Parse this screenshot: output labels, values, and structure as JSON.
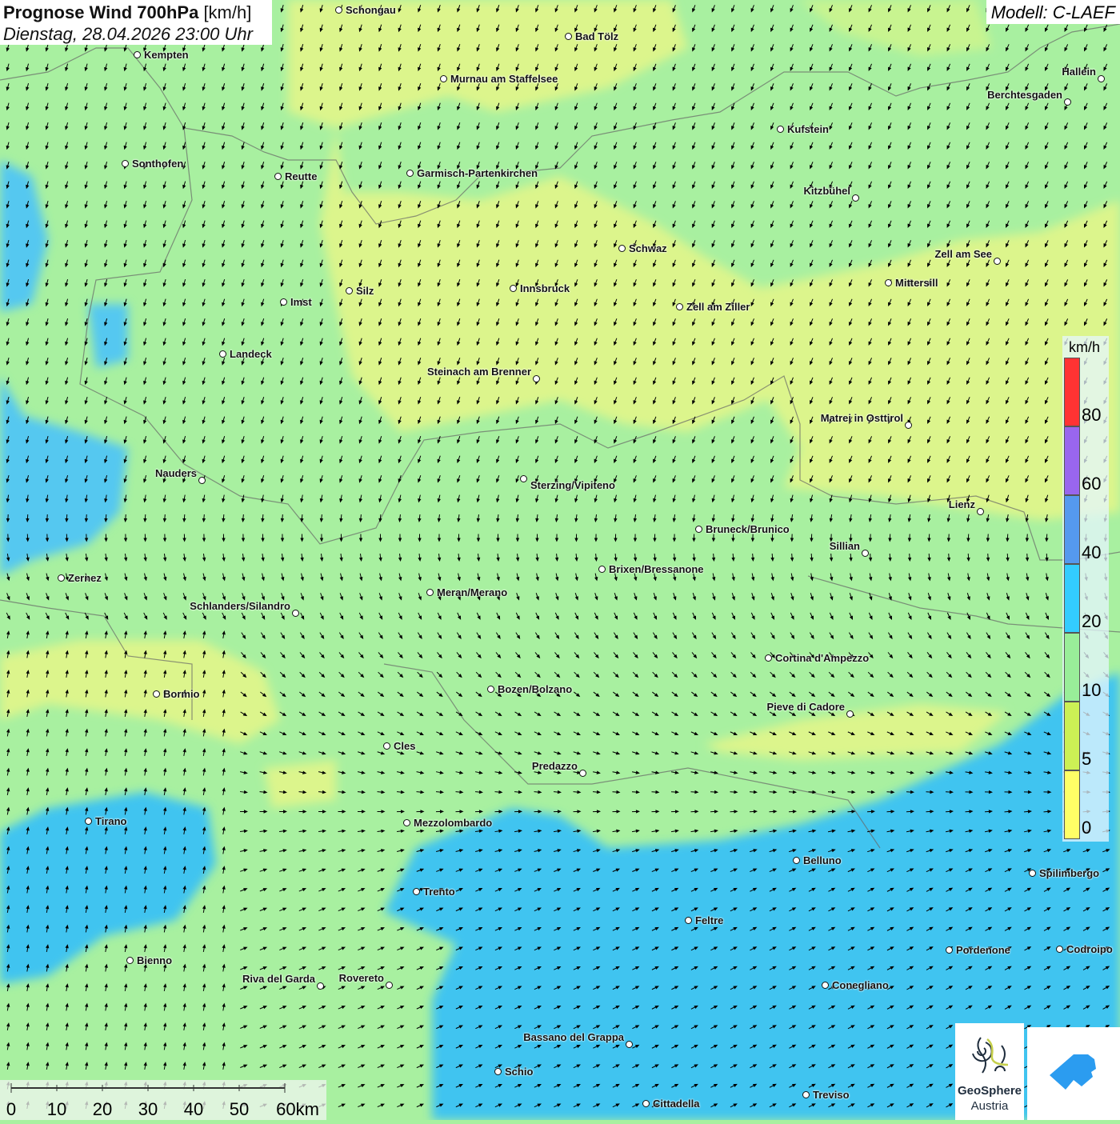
{
  "header": {
    "title_bold": "Prognose Wind 700hPa",
    "title_unit": "[km/h]",
    "datetime": "Dienstag, 28.04.2026 23:00 Uhr",
    "model": "Modell: C-LAEF"
  },
  "legend": {
    "unit": "km/h",
    "labels": [
      "80",
      "60",
      "40",
      "20",
      "10",
      "5",
      "0"
    ],
    "colors": [
      "#ff3333",
      "#9966ee",
      "#5599ee",
      "#33ccff",
      "#99ee99",
      "#ccf055",
      "#ffff66"
    ]
  },
  "scale_bar": {
    "labels": [
      "0",
      "10",
      "20",
      "30",
      "40",
      "50",
      "60km"
    ]
  },
  "logos": {
    "geosphere_line1": "GeoSphere",
    "geosphere_line2": "Austria"
  },
  "cities": [
    "Schongau",
    "Bad Tölz",
    "Kempten",
    "Murnau am Staffelsee",
    "Hallein",
    "Berchtesgaden",
    "Kufstein",
    "Sonthofen",
    "Reutte",
    "Garmisch-Partenkirchen",
    "Kitzbühel",
    "Schwaz",
    "Zell am See",
    "Mittersill",
    "Silz",
    "Innsbruck",
    "Imst",
    "Zell am Ziller",
    "Landeck",
    "Steinach am Brenner",
    "Matrei in Osttirol",
    "Nauders",
    "Sterzing/Vipiteno",
    "Lienz",
    "Bruneck/Brunico",
    "Sillian",
    "Brixen/Bressanone",
    "Zernez",
    "Meran/Merano",
    "Schlanders/Silandro",
    "Cortina d'Ampezzo",
    "Bozen/Bolzano",
    "Bormio",
    "Pieve di Cadore",
    "Cles",
    "Predazzo",
    "Tirano",
    "Mezzolombardo",
    "Belluno",
    "Spilimbergo",
    "Trento",
    "Feltre",
    "Pordenone",
    "Codroipo",
    "Bienno",
    "Riva del Garda",
    "Rovereto",
    "Conegliano",
    "Bassano del Grappa",
    "Schio",
    "Treviso",
    "Cittadella"
  ]
}
